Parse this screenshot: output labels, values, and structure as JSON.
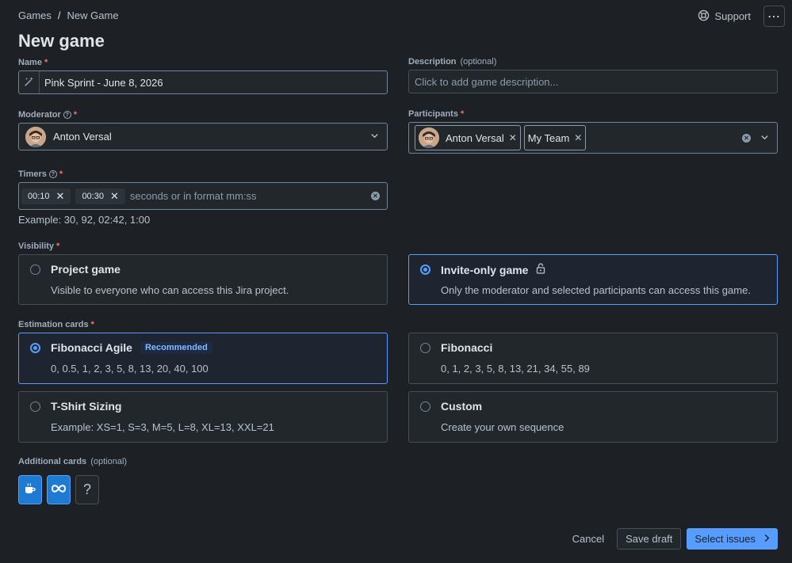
{
  "breadcrumb": {
    "parent": "Games",
    "separator": "/",
    "current": "New Game"
  },
  "header": {
    "support_label": "Support",
    "more_label": "⋯"
  },
  "page": {
    "title": "New game"
  },
  "name_field": {
    "label": "Name",
    "value": "Pink Sprint - June 8, 2026"
  },
  "description_field": {
    "label": "Description",
    "optional": "(optional)",
    "placeholder": "Click to add game description..."
  },
  "moderator_field": {
    "label": "Moderator",
    "value": "Anton Versal"
  },
  "participants_field": {
    "label": "Participants",
    "items": [
      {
        "name": "Anton Versal",
        "has_avatar": true
      },
      {
        "name": "My Team",
        "has_avatar": false
      }
    ]
  },
  "timers_field": {
    "label": "Timers",
    "chips": [
      "00:10",
      "00:30"
    ],
    "placeholder": "seconds or in format mm:ss",
    "hint": "Example: 30, 92, 02:42, 1:00"
  },
  "visibility": {
    "label": "Visibility",
    "options": [
      {
        "title": "Project game",
        "desc": "Visible to everyone who can access this Jira project.",
        "selected": false
      },
      {
        "title": "Invite-only game",
        "desc": "Only the moderator and selected participants can access this game.",
        "selected": true
      }
    ]
  },
  "estimation": {
    "label": "Estimation cards",
    "recommended_badge": "Recommended",
    "options": [
      {
        "title": "Fibonacci Agile",
        "desc": "0, 0.5, 1, 2, 3, 5, 8, 13, 20, 40, 100",
        "selected": true
      },
      {
        "title": "Fibonacci",
        "desc": "0, 1, 2, 3, 5, 8, 13, 21, 34, 55, 89",
        "selected": false
      },
      {
        "title": "T-Shirt Sizing",
        "desc": "Example: XS=1, S=3, M=5, L=8, XL=13, XXL=21",
        "selected": false
      },
      {
        "title": "Custom",
        "desc": "Create your own sequence",
        "selected": false
      }
    ]
  },
  "additional_cards": {
    "label": "Additional cards",
    "optional": "(optional)",
    "items": [
      {
        "icon": "coffee-icon",
        "on": true
      },
      {
        "icon": "infinity-icon",
        "on": true
      },
      {
        "icon": "question-icon",
        "glyph": "?",
        "on": false
      }
    ]
  },
  "footer": {
    "cancel_label": "Cancel",
    "draft_label": "Save draft",
    "primary_label": "Select issues"
  },
  "colors": {
    "accent": "#579dff",
    "background": "#1d2125",
    "required": "#f87168"
  }
}
